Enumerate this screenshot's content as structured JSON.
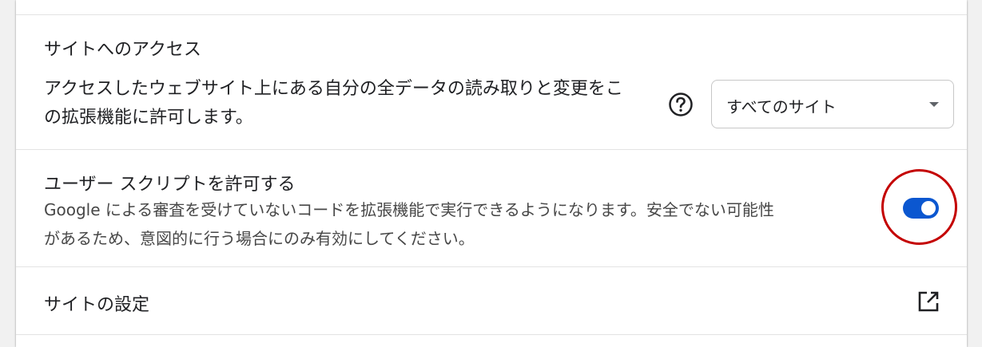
{
  "site_access": {
    "heading": "サイトへのアクセス",
    "description_line1": "アクセスしたウェブサイト上にある自分の全データの読み取りと変更をこ",
    "description_line2": "の拡張機能に許可します。",
    "help_icon": "help-circle-icon",
    "dropdown_value": "すべてのサイト",
    "dropdown_icon": "caret-down-icon"
  },
  "user_scripts": {
    "heading": "ユーザー スクリプトを許可する",
    "description_line1": "Google による審査を受けていないコードを拡張機能で実行できるようになります。安全でない可能性",
    "description_line2": "があるため、意図的に行う場合にのみ有効にしてください。",
    "toggle_state": "on",
    "toggle_color": "#0b57d0",
    "highlight_color": "#c40000"
  },
  "site_settings": {
    "label": "サイトの設定",
    "icon": "open-in-new-icon"
  }
}
